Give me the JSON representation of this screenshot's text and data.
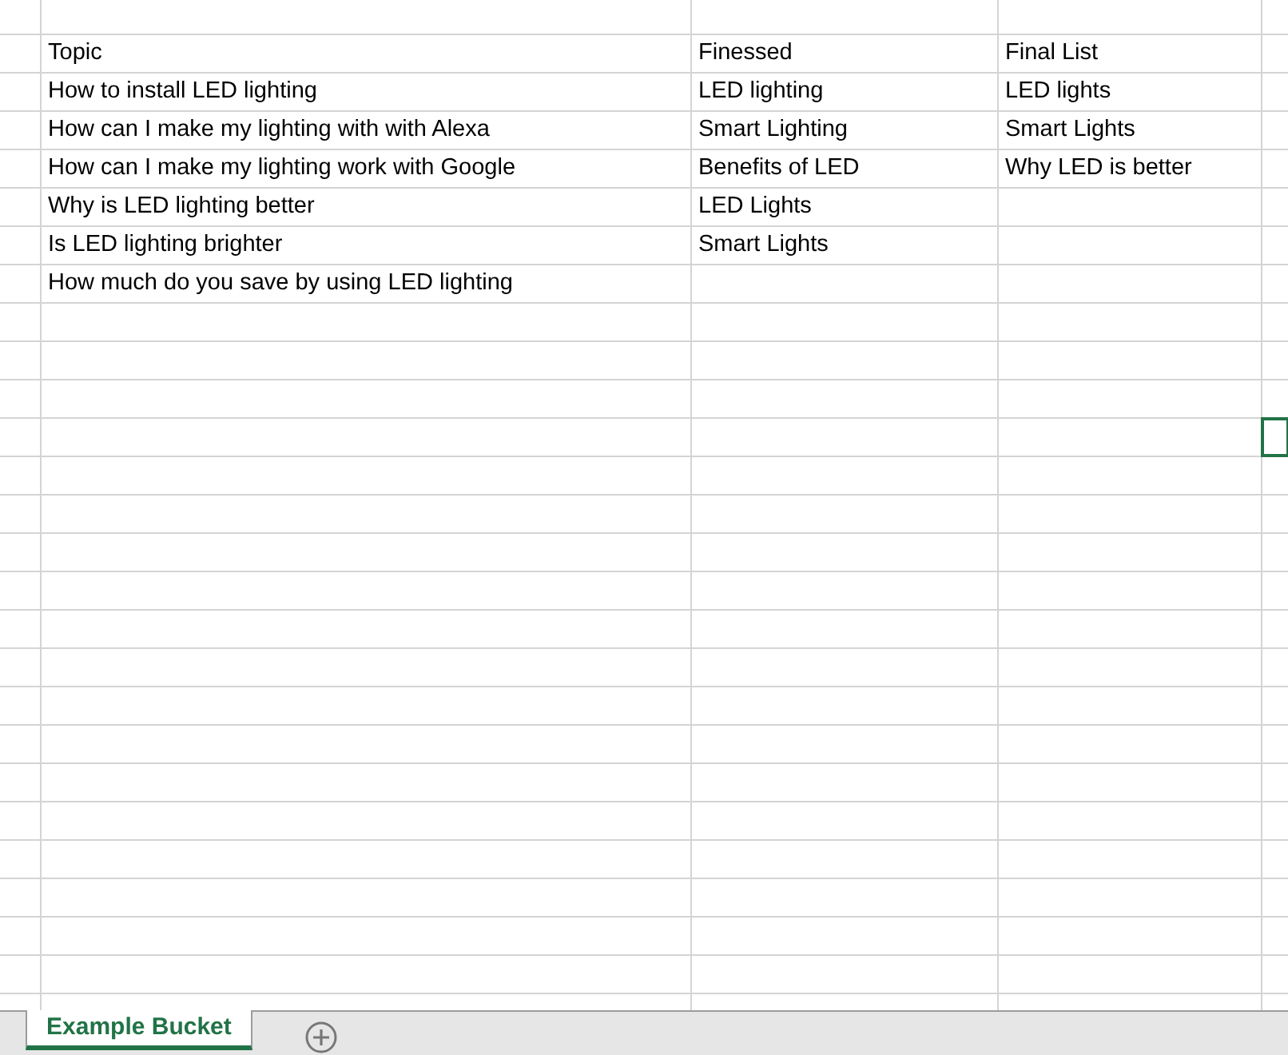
{
  "sheet": {
    "rows": [
      {
        "cells": [
          "Topic",
          "Finessed",
          "Final List"
        ]
      },
      {
        "cells": [
          "How to install LED lighting",
          "LED lighting",
          "LED lights"
        ]
      },
      {
        "cells": [
          "How can I make my lighting with with Alexa",
          "Smart Lighting",
          "Smart Lights"
        ]
      },
      {
        "cells": [
          "How can I make my lighting work with Google",
          "Benefits of LED",
          "Why LED is better"
        ]
      },
      {
        "cells": [
          "Why is LED lighting better",
          "LED Lights"
        ]
      },
      {
        "cells": [
          "Is LED lighting brighter",
          "Smart Lights"
        ]
      },
      {
        "cells": [
          "How much do you save by using LED lighting"
        ]
      }
    ]
  },
  "sheet_tabs": [
    {
      "label": "Example Bucket",
      "selected": true
    }
  ]
}
